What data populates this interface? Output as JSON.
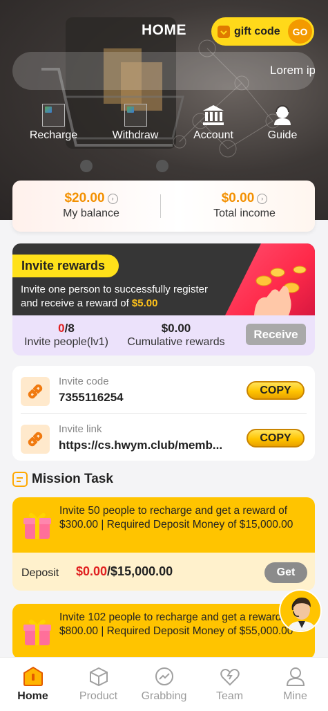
{
  "header": {
    "title": "HOME",
    "gift_code": {
      "label": "gift code",
      "go": "GO"
    },
    "marquee": "Lorem ip"
  },
  "quick_actions": [
    {
      "label": "Recharge",
      "icon": "broken-image-icon"
    },
    {
      "label": "Withdraw",
      "icon": "broken-image-icon"
    },
    {
      "label": "Account",
      "icon": "bank-icon"
    },
    {
      "label": "Guide",
      "icon": "support-agent-icon"
    }
  ],
  "balance": {
    "my_balance_value": "$20.00",
    "my_balance_label": "My balance",
    "total_income_value": "$0.00",
    "total_income_label": "Total income"
  },
  "invite_rewards": {
    "title": "Invite rewards",
    "desc_line1": "Invite one person to successfully register",
    "desc_line2": "and receive a reward of ",
    "reward_amount": "$5.00",
    "invite_current": "0",
    "invite_total": "/8",
    "invite_label": "Invite people(lv1)",
    "cumulative_value": "$0.00",
    "cumulative_label": "Cumulative rewards",
    "receive_label": "Receive"
  },
  "invite_info": {
    "code_label": "Invite code",
    "code_value": "7355116254",
    "link_label": "Invite link",
    "link_value": "https://cs.hwym.club/memb...",
    "copy_label": "COPY"
  },
  "mission": {
    "title": "Mission Task",
    "tasks": [
      {
        "text": "Invite 50 people to recharge and get a reward of $300.00 | Required Deposit Money of $15,000.00",
        "deposit_label": "Deposit",
        "deposit_current": "$0.00",
        "deposit_target": "/$15,000.00",
        "button": "Get"
      },
      {
        "text": "Invite 102 people to recharge and get a reward of $800.00 | Required Deposit Money of $55,000.00"
      }
    ]
  },
  "bottom_nav": [
    {
      "label": "Home",
      "icon": "home-icon",
      "active": true
    },
    {
      "label": "Product",
      "icon": "box-icon"
    },
    {
      "label": "Grabbing",
      "icon": "trend-icon"
    },
    {
      "label": "Team",
      "icon": "team-icon"
    },
    {
      "label": "Mine",
      "icon": "user-icon"
    }
  ],
  "colors": {
    "accent": "#ffc400",
    "orange": "#f39000",
    "red": "#e02020",
    "dark": "#363636"
  }
}
